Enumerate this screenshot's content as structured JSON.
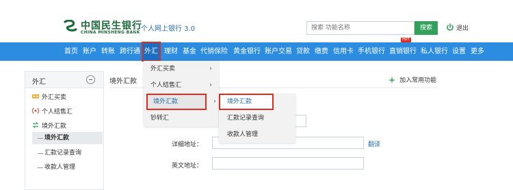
{
  "header": {
    "bank_name_cn": "中国民生银行",
    "bank_name_en": "CHINA MINSHENG BANK",
    "site_title": "个人网上银行 3.0",
    "search_placeholder": "搜索 功能名称",
    "search_button": "搜索",
    "logout": "退出",
    "brand_color": "#1d6b3a",
    "accent_color": "#33a05b"
  },
  "nav": {
    "background": "#2b8ce0",
    "items": [
      "首页",
      "账户",
      "转账",
      "跨行通",
      "外汇",
      "理财",
      "基金",
      "代销保险",
      "黄金银行",
      "账户交易",
      "贷款",
      "缴费",
      "信用卡",
      "手机银行",
      "直销银行",
      "私人银行",
      "设置",
      "更多"
    ],
    "active": "外汇",
    "hot_badge": "HOT"
  },
  "sidebar": {
    "title": "外汇",
    "items": [
      "外汇买卖",
      "个人结售汇",
      "境外汇款"
    ],
    "subitems": [
      "境外汇款",
      "汇款记录查询",
      "收款人管理"
    ],
    "active_subitem": "境外汇款"
  },
  "main": {
    "title": "境外汇款",
    "add_common": "加入常用功能",
    "fields": [
      {
        "label": "详细地址：",
        "value": ""
      },
      {
        "label": "英文地址：",
        "value": ""
      }
    ],
    "translate_link": "翻译"
  },
  "dropdown": {
    "level1": [
      "外汇买卖",
      "个人结售汇",
      "境外汇款",
      "钞转汇"
    ],
    "level1_highlight": "境外汇款",
    "level2": [
      "境外汇款",
      "汇款记录查询",
      "收款人管理"
    ],
    "level2_highlight": "境外汇款",
    "chevron": "›"
  }
}
